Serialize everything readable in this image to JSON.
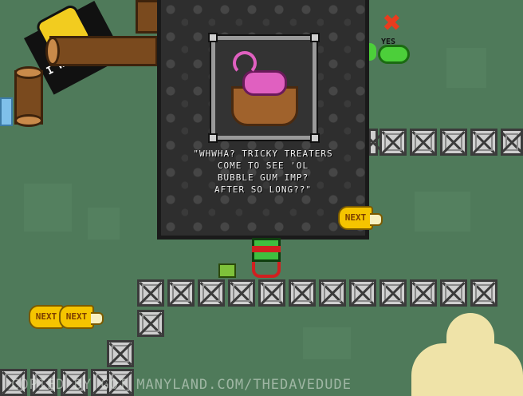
{
  "dialog": {
    "text": "\"WHWHA? TRICKY TREATERS\nCOME TO SEE 'OL\nBUBBLE GUM IMP?\nAFTER SO LONG??\""
  },
  "next_buttons": [
    {
      "label": "NEXT"
    },
    {
      "label": "NEXT"
    },
    {
      "label": "NEXT"
    }
  ],
  "top_right": {
    "yes_label": "YES"
  },
  "sign": {
    "text": "I WANT"
  },
  "footer": {
    "text": "COPIED BY GOT MANYLAND.COM/THEDAVEDUDE"
  },
  "colors": {
    "background": "#4f7a5a",
    "crate": "#cfcfcf",
    "next_button": "#f5c400",
    "player_green": "#3fbf3f",
    "player_red": "#d02020",
    "imp_pink": "#e060c0"
  }
}
